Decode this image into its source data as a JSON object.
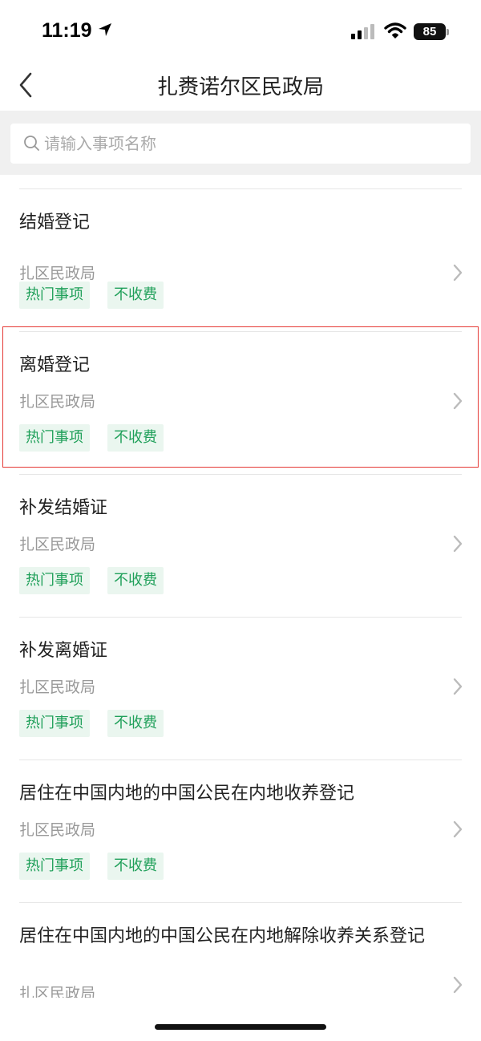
{
  "status_bar": {
    "time": "11:19",
    "battery": "85"
  },
  "header": {
    "title": "扎赉诺尔区民政局"
  },
  "search": {
    "placeholder": "请输入事项名称"
  },
  "items": [
    {
      "name": "结婚登记",
      "dept": "扎区民政局",
      "tags": [
        "热门事项",
        "不收费"
      ]
    },
    {
      "name": "离婚登记",
      "dept": "扎区民政局",
      "tags": [
        "热门事项",
        "不收费"
      ]
    },
    {
      "name": "补发结婚证",
      "dept": "扎区民政局",
      "tags": [
        "热门事项",
        "不收费"
      ]
    },
    {
      "name": "补发离婚证",
      "dept": "扎区民政局",
      "tags": [
        "热门事项",
        "不收费"
      ]
    },
    {
      "name": "居住在中国内地的中国公民在内地收养登记",
      "dept": "扎区民政局",
      "tags": [
        "热门事项",
        "不收费"
      ]
    },
    {
      "name": "居住在中国内地的中国公民在内地解除收养关系登记",
      "dept": "扎区民政局",
      "tags": []
    }
  ],
  "colors": {
    "tag_bg": "#eaf6ef",
    "tag_text": "#20a05a",
    "highlight": "#e53935"
  }
}
